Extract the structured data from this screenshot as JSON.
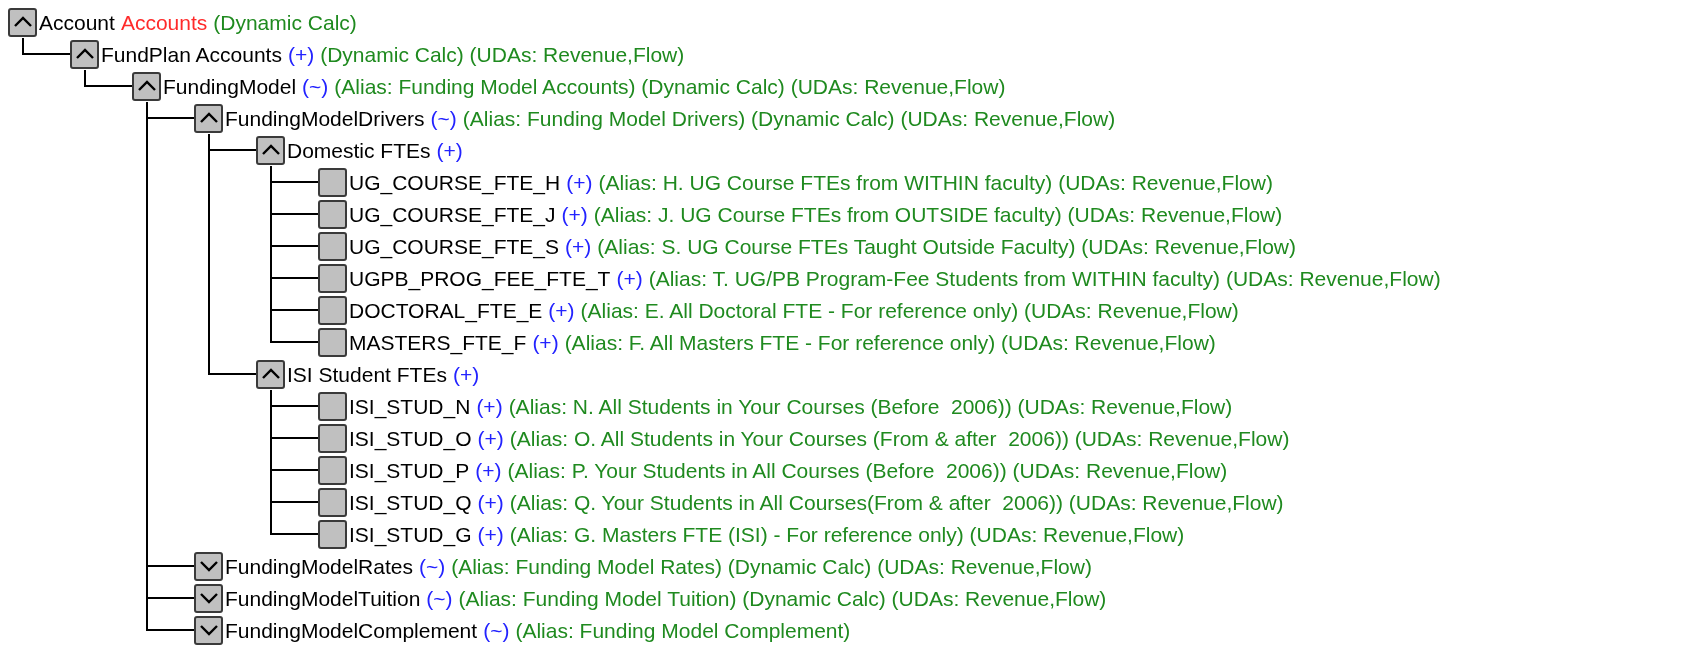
{
  "tree": [
    {
      "label": "Account",
      "tag": "Accounts",
      "info": "(Dynamic Calc)",
      "expanded": true,
      "children": [
        {
          "label": "FundPlan Accounts",
          "op": "(+)",
          "info": "(Dynamic Calc) (UDAs: Revenue,Flow)",
          "expanded": true,
          "children": [
            {
              "label": "FundingModel",
              "op": "(~)",
              "info": "(Alias: Funding Model Accounts) (Dynamic Calc) (UDAs: Revenue,Flow)",
              "expanded": true,
              "children": [
                {
                  "label": "FundingModelDrivers",
                  "op": "(~)",
                  "info": "(Alias: Funding Model Drivers) (Dynamic Calc) (UDAs: Revenue,Flow)",
                  "expanded": true,
                  "children": [
                    {
                      "label": "Domestic FTEs",
                      "op": "(+)",
                      "expanded": true,
                      "children": [
                        {
                          "label": "UG_COURSE_FTE_H",
                          "op": "(+)",
                          "info": "(Alias: H. UG Course FTEs from WITHIN faculty) (UDAs: Revenue,Flow)"
                        },
                        {
                          "label": "UG_COURSE_FTE_J",
                          "op": "(+)",
                          "info": "(Alias: J. UG Course FTEs from OUTSIDE faculty) (UDAs: Revenue,Flow)"
                        },
                        {
                          "label": "UG_COURSE_FTE_S",
                          "op": "(+)",
                          "info": "(Alias: S. UG Course FTEs Taught Outside Faculty) (UDAs: Revenue,Flow)"
                        },
                        {
                          "label": "UGPB_PROG_FEE_FTE_T",
                          "op": "(+)",
                          "info": "(Alias: T. UG/PB Program-Fee Students from WITHIN faculty) (UDAs: Revenue,Flow)"
                        },
                        {
                          "label": "DOCTORAL_FTE_E",
                          "op": "(+)",
                          "info": "(Alias: E. All Doctoral FTE - For reference only) (UDAs: Revenue,Flow)"
                        },
                        {
                          "label": "MASTERS_FTE_F",
                          "op": "(+)",
                          "info": "(Alias: F. All Masters FTE - For reference only) (UDAs: Revenue,Flow)"
                        }
                      ]
                    },
                    {
                      "label": "ISI Student FTEs",
                      "op": "(+)",
                      "expanded": true,
                      "children": [
                        {
                          "label": "ISI_STUD_N",
                          "op": "(+)",
                          "info": "(Alias: N. All Students in Your Courses (Before  2006)) (UDAs: Revenue,Flow)"
                        },
                        {
                          "label": "ISI_STUD_O",
                          "op": "(+)",
                          "info": "(Alias: O. All Students in Your Courses (From & after  2006)) (UDAs: Revenue,Flow)"
                        },
                        {
                          "label": "ISI_STUD_P",
                          "op": "(+)",
                          "info": "(Alias: P. Your Students in All Courses (Before  2006)) (UDAs: Revenue,Flow)"
                        },
                        {
                          "label": "ISI_STUD_Q",
                          "op": "(+)",
                          "info": "(Alias: Q. Your Students in All Courses(From & after  2006)) (UDAs: Revenue,Flow)"
                        },
                        {
                          "label": "ISI_STUD_G",
                          "op": "(+)",
                          "info": "(Alias: G. Masters FTE (ISI) - For reference only) (UDAs: Revenue,Flow)"
                        }
                      ]
                    }
                  ]
                },
                {
                  "label": "FundingModelRates",
                  "op": "(~)",
                  "info": "(Alias: Funding Model Rates) (Dynamic Calc) (UDAs: Revenue,Flow)",
                  "expanded": false
                },
                {
                  "label": "FundingModelTuition",
                  "op": "(~)",
                  "info": "(Alias: Funding Model Tuition) (Dynamic Calc) (UDAs: Revenue,Flow)",
                  "expanded": false
                },
                {
                  "label": "FundingModelComplement",
                  "op": "(~)",
                  "info": "(Alias: Funding Model Complement)",
                  "expanded": false
                }
              ]
            }
          ]
        }
      ]
    }
  ]
}
